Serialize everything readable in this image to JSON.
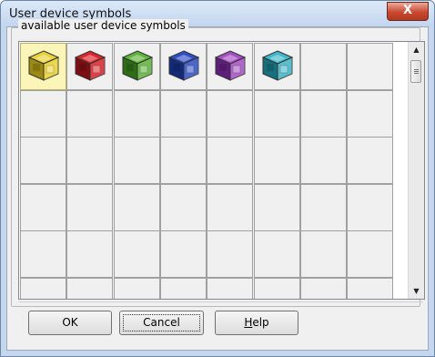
{
  "window": {
    "title": "User device symbols",
    "close_label": "X"
  },
  "group": {
    "label": "available user device symbols"
  },
  "symbols": [
    {
      "name": "yellow",
      "color": "#e9d23a",
      "dark": "#9c8a12",
      "selected": true
    },
    {
      "name": "red",
      "color": "#d9262b",
      "dark": "#7d0f12",
      "selected": false
    },
    {
      "name": "green",
      "color": "#5fb33a",
      "dark": "#2e6d16",
      "selected": false
    },
    {
      "name": "blue",
      "color": "#2f4ec4",
      "dark": "#122a7a",
      "selected": false
    },
    {
      "name": "purple",
      "color": "#a64fc4",
      "dark": "#5e1f7c",
      "selected": false
    },
    {
      "name": "cyan",
      "color": "#3fb7c9",
      "dark": "#17707d",
      "selected": false
    }
  ],
  "scrollbar": {
    "up_icon": "▲",
    "down_icon": "▼"
  },
  "buttons": {
    "ok": "OK",
    "cancel": "Cancel",
    "help": "Help"
  }
}
